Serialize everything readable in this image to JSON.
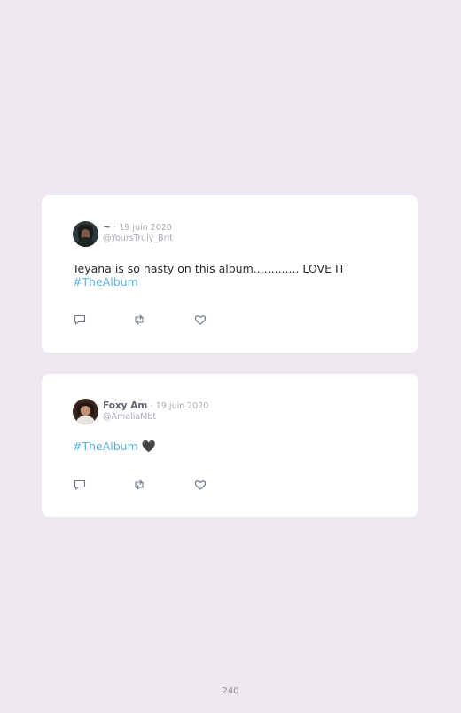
{
  "tweets": [
    {
      "name": "~",
      "separator": "·",
      "date": "19 juin 2020",
      "handle": "@YoursTruly_Brit",
      "text": "Teyana is so nasty on this album............. LOVE IT",
      "hashtag": "#TheAlbum",
      "emoji": ""
    },
    {
      "name": "Foxy Am",
      "separator": "·",
      "date": "19 juin 2020",
      "handle": "@AmaliaMbt",
      "text": "",
      "hashtag": "#TheAlbum",
      "emoji": "🖤"
    }
  ],
  "page_number": "240",
  "icons": {
    "reply": "reply-icon",
    "retweet": "retweet-icon",
    "like": "heart-icon"
  },
  "colors": {
    "background": "#ede8ef",
    "card": "#ffffff",
    "hashtag": "#5db0e0",
    "muted": "#a6adb4"
  }
}
